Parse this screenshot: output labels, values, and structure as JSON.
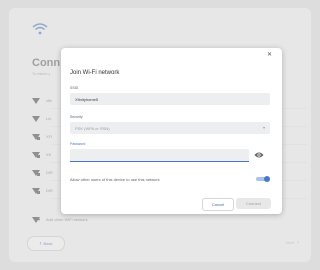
{
  "background": {
    "title": "Conn",
    "subtitle": "To restore y",
    "networks": [
      {
        "name": "xfin",
        "signal": "full"
      },
      {
        "name": "Lin",
        "signal": "full"
      },
      {
        "name": "XFI",
        "signal": "partial"
      },
      {
        "name": "Xfi",
        "signal": "partial"
      },
      {
        "name": "DIR",
        "signal": "partial"
      },
      {
        "name": "DIR",
        "signal": "partial"
      },
      {
        "name": "Add other WiFi network",
        "signal": "add"
      }
    ],
    "back_label": "Back",
    "next_label": "Next"
  },
  "dialog": {
    "title": "Join Wi-Fi network",
    "ssid_label": "SSID",
    "ssid_value": "Xfinityhome5",
    "security_label": "Security",
    "security_value": "PSK (WPA or RSN)",
    "password_label": "Password",
    "password_value": "",
    "share_label": "Allow other users of this device to use this network",
    "share_enabled": true,
    "cancel_label": "Cancel",
    "connect_label": "Connect"
  },
  "colors": {
    "accent": "#4a78c9",
    "background": "#f1f1f1"
  }
}
